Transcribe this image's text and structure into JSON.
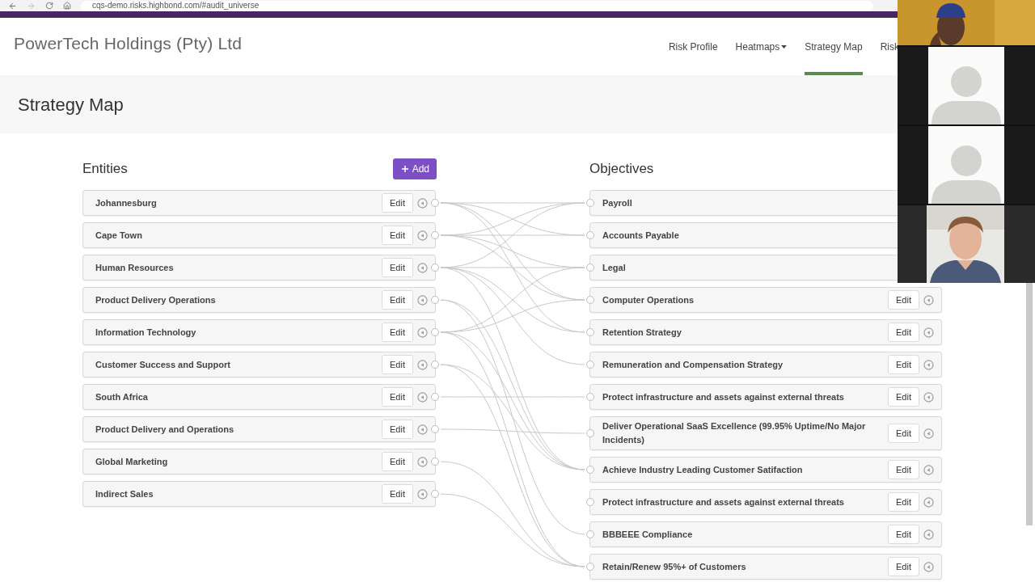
{
  "browser": {
    "url": "cqs-demo.risks.highbond.com/#audit_universe"
  },
  "header": {
    "company": "PowerTech Holdings (Pty) Ltd",
    "nav": [
      {
        "label": "Risk Profile",
        "kind": "link",
        "selected": false
      },
      {
        "label": "Heatmaps",
        "kind": "dropdown",
        "selected": false
      },
      {
        "label": "Strategy Map",
        "kind": "link",
        "selected": true
      },
      {
        "label": "Risk",
        "kind": "link",
        "selected": false
      }
    ]
  },
  "page_title": "Strategy Map",
  "entities": {
    "title": "Entities",
    "add_button": "Add",
    "items": [
      {
        "name": "Johannesburg",
        "edit": "Edit"
      },
      {
        "name": "Cape Town",
        "edit": "Edit"
      },
      {
        "name": "Human Resources",
        "edit": "Edit"
      },
      {
        "name": "Product Delivery Operations",
        "edit": "Edit"
      },
      {
        "name": "Information Technology",
        "edit": "Edit"
      },
      {
        "name": "Customer Success and Support",
        "edit": "Edit"
      },
      {
        "name": "South Africa",
        "edit": "Edit"
      },
      {
        "name": "Product Delivery and Operations",
        "edit": "Edit"
      },
      {
        "name": "Global Marketing",
        "edit": "Edit"
      },
      {
        "name": "Indirect Sales",
        "edit": "Edit"
      }
    ]
  },
  "objectives": {
    "title": "Objectives",
    "items": [
      {
        "name": "Payroll"
      },
      {
        "name": "Accounts Payable"
      },
      {
        "name": "Legal"
      },
      {
        "name": "Computer Operations",
        "edit": "Edit"
      },
      {
        "name": "Retention Strategy",
        "edit": "Edit"
      },
      {
        "name": "Remuneration and Compensation Strategy",
        "edit": "Edit"
      },
      {
        "name": "Protect infrastructure and assets against external threats",
        "edit": "Edit"
      },
      {
        "name": "Deliver Operational SaaS Excellence (99.95% Uptime/No Major Incidents)",
        "edit": "Edit"
      },
      {
        "name": "Achieve Industry Leading Customer Satifaction",
        "edit": "Edit"
      },
      {
        "name": "Protect infrastructure and assets against external threats",
        "edit": "Edit"
      },
      {
        "name": "BBBEEE Compliance",
        "edit": "Edit"
      },
      {
        "name": "Retain/Renew 95%+ of Customers",
        "edit": "Edit"
      }
    ]
  },
  "video_call": {
    "tiles": [
      {
        "kind": "camera"
      },
      {
        "kind": "avatar"
      },
      {
        "kind": "avatar"
      },
      {
        "kind": "camera"
      }
    ]
  }
}
